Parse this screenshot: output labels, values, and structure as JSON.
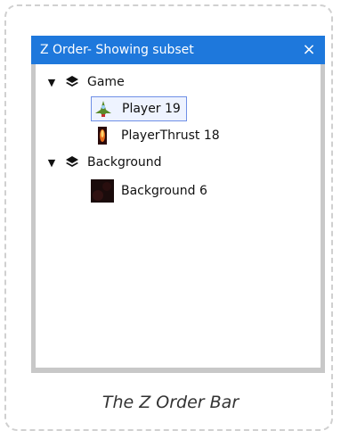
{
  "window": {
    "title": "Z Order- Showing subset",
    "close_label": "×"
  },
  "tree": {
    "layers": [
      {
        "label": "Game",
        "expanded": true,
        "icon": "layers-icon",
        "objects": [
          {
            "label": "Player 19",
            "selected": true,
            "icon": "player-ship-thumbnail"
          },
          {
            "label": "PlayerThrust 18",
            "selected": false,
            "icon": "thrust-flame-thumbnail"
          }
        ]
      },
      {
        "label": "Background",
        "expanded": true,
        "icon": "layers-icon",
        "objects": [
          {
            "label": "Background 6",
            "selected": false,
            "icon": "background-thumbnail"
          }
        ]
      }
    ]
  },
  "caption": "The Z Order Bar",
  "colors": {
    "titlebar": "#1e78dc",
    "panel_border": "#c8c8c8",
    "selection_border": "#6f8fe6"
  }
}
